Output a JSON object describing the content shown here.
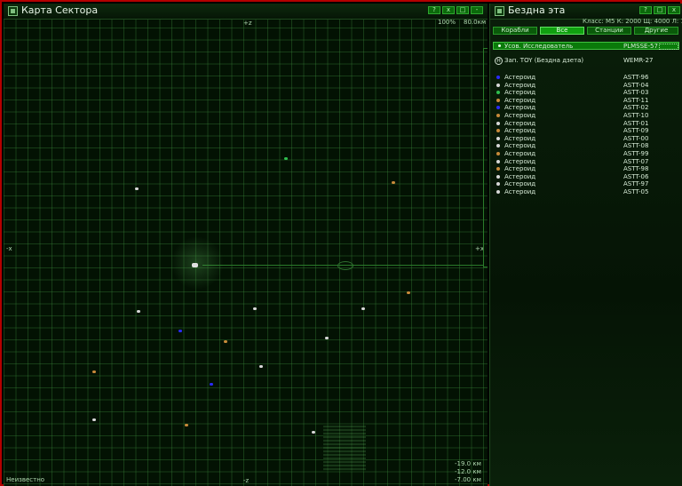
{
  "map": {
    "title": "Карта Сектора",
    "zoom": "100%",
    "range": "80.0км",
    "axis_top": "+z",
    "axis_bottom": "-z",
    "axis_left": "-x",
    "axis_right": "+x",
    "status": "Неизвестно",
    "coords": [
      "-19.0 км",
      "-12.0 км",
      "-7.00 км"
    ],
    "window_buttons": [
      "?",
      "x",
      "□",
      "-"
    ]
  },
  "panel": {
    "title": "Бездна эта",
    "info": "Класс: M5  К: 2000  Щ: 4000  Л: 1200",
    "tabs": [
      "Корабли",
      "Все",
      "Станции",
      "Другие"
    ],
    "active_tab": "Все",
    "selected": {
      "name": "Усов. Исследователь",
      "code": "PLMSSE-57"
    },
    "station": {
      "name": "Зап. TOY (Бездна дзета)",
      "code": "WEMR-27"
    },
    "objects": [
      {
        "name": "Астероид",
        "code": "ASTT-96",
        "color": "#2a2aff"
      },
      {
        "name": "Астероид",
        "code": "ASTT-04",
        "color": "#d8d8d8"
      },
      {
        "name": "Астероид",
        "code": "ASTT-03",
        "color": "#2fbf4f"
      },
      {
        "name": "Астероид",
        "code": "ASTT-11",
        "color": "#c98a3a"
      },
      {
        "name": "Астероид",
        "code": "ASTT-02",
        "color": "#2a2aff"
      },
      {
        "name": "Астероид",
        "code": "ASTT-10",
        "color": "#c98a3a"
      },
      {
        "name": "Астероид",
        "code": "ASTT-01",
        "color": "#d8d8d8"
      },
      {
        "name": "Астероид",
        "code": "ASTT-09",
        "color": "#c98a3a"
      },
      {
        "name": "Астероид",
        "code": "ASTT-00",
        "color": "#d8d8d8"
      },
      {
        "name": "Астероид",
        "code": "ASTT-08",
        "color": "#d8d8d8"
      },
      {
        "name": "Астероид",
        "code": "ASTT-99",
        "color": "#c98a3a"
      },
      {
        "name": "Астероид",
        "code": "ASTT-07",
        "color": "#d8d8d8"
      },
      {
        "name": "Астероид",
        "code": "ASTT-98",
        "color": "#c98a3a"
      },
      {
        "name": "Астероид",
        "code": "ASTT-06",
        "color": "#d8d8d8"
      },
      {
        "name": "Астероид",
        "code": "ASTT-97",
        "color": "#d8d8d8"
      },
      {
        "name": "Астероид",
        "code": "ASTT-05",
        "color": "#d8d8d8"
      }
    ]
  }
}
